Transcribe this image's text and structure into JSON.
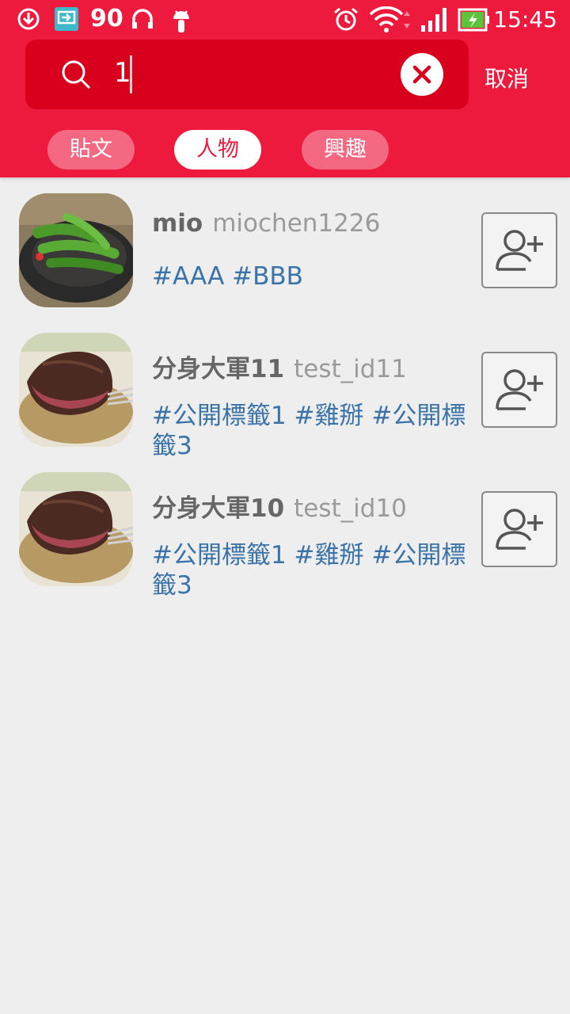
{
  "status_bar": {
    "notification_count": "90",
    "time": "15:45",
    "icons": [
      "download-icon",
      "screen-cast-icon",
      "headset-icon",
      "android-icon",
      "alarm-icon",
      "wifi-icon",
      "signal-icon",
      "battery-charging-icon"
    ]
  },
  "search": {
    "value": "1",
    "clear_icon": "close-icon",
    "cancel_label": "取消"
  },
  "tabs": [
    {
      "label": "貼文",
      "active": false
    },
    {
      "label": "人物",
      "active": true
    },
    {
      "label": "興趣",
      "active": false
    }
  ],
  "people": [
    {
      "name": "mio",
      "user_id": "miochen1226",
      "tags": "#AAA #BBB",
      "avatar": "edamame-photo"
    },
    {
      "name": "分身大軍11",
      "user_id": "test_id11",
      "tags": "#公開標籤1 #雞掰 #公開標籤3",
      "avatar": "steak-photo"
    },
    {
      "name": "分身大軍10",
      "user_id": "test_id10",
      "tags": "#公開標籤1 #雞掰 #公開標籤3",
      "avatar": "steak-photo"
    }
  ],
  "colors": {
    "header": "#ee1a3e",
    "search_box": "#d8001c",
    "tag_link": "#3a73a8",
    "background": "#eeeeee"
  }
}
